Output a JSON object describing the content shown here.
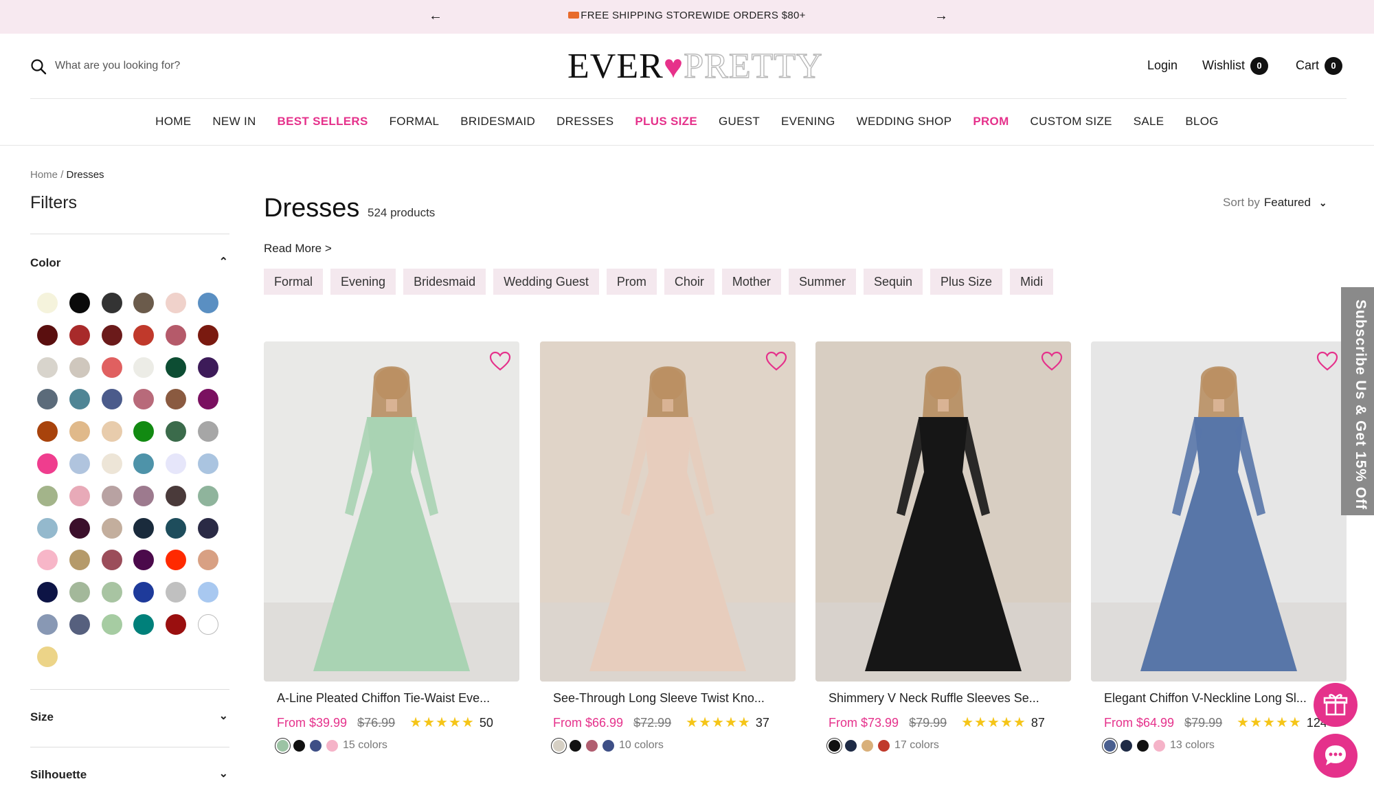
{
  "announcement": {
    "message": "FREE SHIPPING STOREWIDE ORDERS $80+",
    "prev_icon": "←",
    "next_icon": "→"
  },
  "header": {
    "search_placeholder": "What are you looking for?",
    "logo_left": "EVER",
    "logo_right": "PRETTY",
    "login": "Login",
    "wishlist": "Wishlist",
    "wishlist_count": "0",
    "cart": "Cart",
    "cart_count": "0"
  },
  "nav": [
    "HOME",
    "NEW IN",
    "BEST SELLERS",
    "FORMAL",
    "BRIDESMAID",
    "DRESSES",
    "PLUS SIZE",
    "GUEST",
    "EVENING",
    "WEDDING SHOP",
    "PROM",
    "CUSTOM SIZE",
    "SALE",
    "BLOG"
  ],
  "nav_highlight": [
    "BEST SELLERS",
    "PLUS SIZE",
    "PROM"
  ],
  "breadcrumb": {
    "home": "Home",
    "sep": "/",
    "current": "Dresses"
  },
  "filters": {
    "title": "Filters",
    "color_label": "Color",
    "size_label": "Size",
    "silhouette_label": "Silhouette",
    "colors": [
      "#f5f3dc",
      "#0a0a0a",
      "#333333",
      "#6b5b4b",
      "#f0d2cb",
      "#5a8fc2",
      "#5a0f0f",
      "#a82a2a",
      "#6b1a1a",
      "#c0392b",
      "#b55a6a",
      "#7a1a10",
      "#d8d4cc",
      "#cfc7bd",
      "#e06060",
      "#ecece6",
      "#0d4d33",
      "#3d1b59",
      "#5b6b7a",
      "#4f8595",
      "#4b5b8b",
      "#b86a7a",
      "#8a5a40",
      "#7a1060",
      "#a8430c",
      "#e0b98a",
      "#e8ccac",
      "#128a12",
      "#3b6b4b",
      "#a6a6a6",
      "#ef3d8e",
      "#b0c4de",
      "#ede5d7",
      "#4e93a9",
      "#e6e6fa",
      "#aac4e0",
      "#a3b48a",
      "#e8aab8",
      "#b8a2a2",
      "#9d7a8e",
      "#4a3a3a",
      "#8fb49c",
      "#94b9cd",
      "#3b0f2b",
      "#c3ae9d",
      "#1a2b3c",
      "#1e4d5c",
      "#2a2a45",
      "#f7b6c8",
      "#b59a6a",
      "#9b4d5a",
      "#4b0a4b",
      "#ff2a00",
      "#d8a083",
      "#0d1445",
      "#a3b89a",
      "#a8c4a2",
      "#1e3a9a",
      "#c0c0c0",
      "#a8c8f0",
      "#8898b4",
      "#56607e",
      "#a6cca2",
      "#00807a",
      "#9a0f0f",
      "#ffffff",
      "#ecd488"
    ]
  },
  "main": {
    "title": "Dresses",
    "count": "524 products",
    "read_more": "Read More >",
    "sort_label": "Sort by",
    "sort_value": "Featured",
    "chips": [
      "Formal",
      "Evening",
      "Bridesmaid",
      "Wedding Guest",
      "Prom",
      "Choir",
      "Mother",
      "Summer",
      "Sequin",
      "Plus Size",
      "Midi"
    ]
  },
  "products": [
    {
      "name": "A-Line Pleated Chiffon Tie-Waist Eve...",
      "price": "From $39.99",
      "compare": "$76.99",
      "reviews": "50",
      "colors_text": "15 colors",
      "swatches": [
        "#9cc3a4",
        "#111111",
        "#3e4f86",
        "#f5b3c8"
      ],
      "dress": "#a9d3b3",
      "bg": "#e9e9e7"
    },
    {
      "name": "See-Through Long Sleeve Twist Kno...",
      "price": "From $66.99",
      "compare": "$72.99",
      "reviews": "37",
      "colors_text": "10 colors",
      "swatches": [
        "#d6d0c4",
        "#111111",
        "#b15e70",
        "#3e4f86"
      ],
      "dress": "#e7cdbd",
      "bg": "#e0d4c8"
    },
    {
      "name": "Shimmery V Neck Ruffle Sleeves Se...",
      "price": "From $73.99",
      "compare": "$79.99",
      "reviews": "87",
      "colors_text": "17 colors",
      "swatches": [
        "#111111",
        "#1e2a45",
        "#d9b07a",
        "#c0392b"
      ],
      "dress": "#161616",
      "bg": "#d8cec2"
    },
    {
      "name": "Elegant Chiffon V-Neckline Long Sl...",
      "price": "From $64.99",
      "compare": "$79.99",
      "reviews": "124",
      "colors_text": "13 colors",
      "swatches": [
        "#4a5f8f",
        "#1e2a45",
        "#111111",
        "#f5b3c8"
      ],
      "dress": "#5876a8",
      "bg": "#e6e6e6"
    }
  ],
  "stars": "★★★★★",
  "subscribe": "Subscribe Us & Get 15% Off"
}
